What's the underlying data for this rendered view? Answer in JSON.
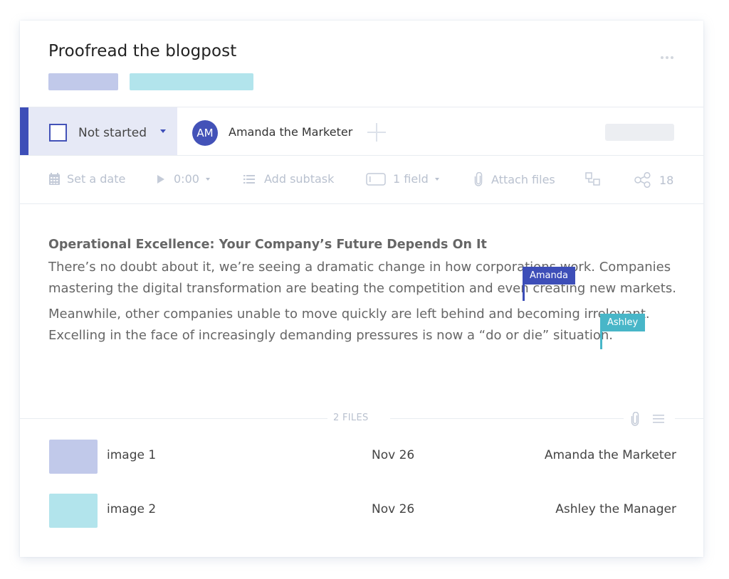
{
  "task": {
    "title": "Proofread the blogpost",
    "tags": [
      {
        "color": "#c1c9ea"
      },
      {
        "color": "#b2e4ec"
      }
    ],
    "more_icon": "ellipsis-icon"
  },
  "status": {
    "label": "Not started",
    "accent": "#3d4eb8",
    "background": "#e6e9f6"
  },
  "assignee": {
    "initials": "AM",
    "name": "Amanda the Marketer",
    "avatar_color": "#4352b8",
    "add_icon": "plus-icon"
  },
  "toolbar": {
    "set_date": "Set a date",
    "timer": "0:00",
    "add_subtask": "Add subtask",
    "field": "1 field",
    "attach_files": "Attach files",
    "dependencies_icon": "dependency-icon",
    "share_count": "18"
  },
  "document": {
    "heading": "Operational Excellence: Your Company’s Future Depends On It",
    "paragraph1": "There’s no doubt about it, we’re seeing a dramatic change in how corporations work. Companies mastering the digital transformation are beating the competition and even creating new markets.",
    "paragraph2": "Meanwhile, other companies unable to move quickly are left behind and becoming irrelevant. Excelling in the face of increasingly demanding pressures is now a “do or die” situation."
  },
  "collaborators": [
    {
      "name": "Amanda",
      "color": "#3d4eb8"
    },
    {
      "name": "Ashley",
      "color": "#48b6c8"
    }
  ],
  "files": {
    "count_label": "2 FILES",
    "items": [
      {
        "name": "image 1",
        "date": "Nov 26",
        "owner": "Amanda the Marketer",
        "thumb_color": "#c1c9ea"
      },
      {
        "name": "image 2",
        "date": "Nov 26",
        "owner": "Ashley the Manager",
        "thumb_color": "#b2e4ec"
      }
    ]
  }
}
